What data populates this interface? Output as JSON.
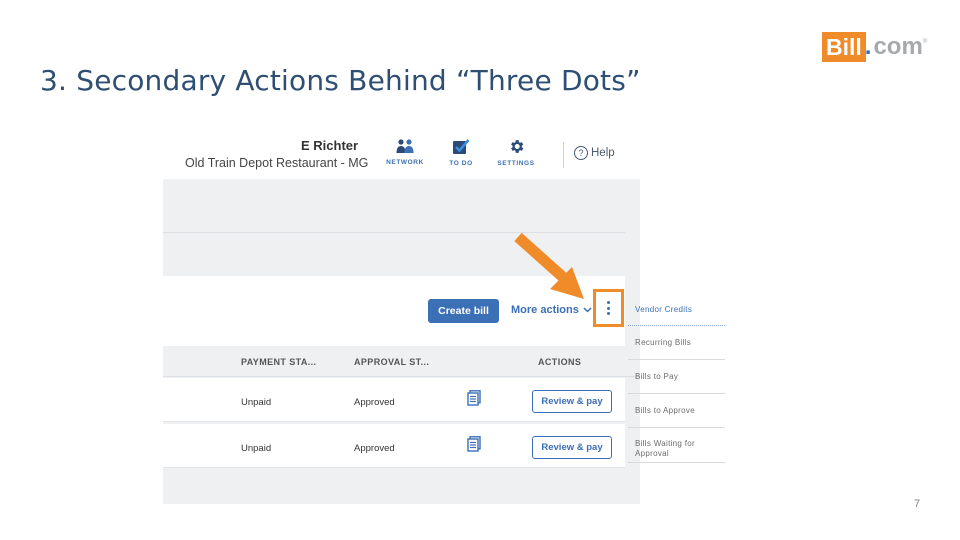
{
  "slide": {
    "title": "3. Secondary Actions Behind “Three Dots”",
    "page_number": "7",
    "logo": {
      "box_text": "Bill",
      "rest_text": "com",
      "dot_text": ".",
      "tm": "®"
    }
  },
  "app": {
    "user_name": "E Richter",
    "company": "Old Train Depot Restaurant - MG",
    "nav": [
      {
        "label": "NETWORK",
        "icon": "people-icon"
      },
      {
        "label": "TO DO",
        "icon": "checkbox-icon"
      },
      {
        "label": "SETTINGS",
        "icon": "gear-icon"
      }
    ],
    "help_label": "Help",
    "help_glyph": "?",
    "create_bill_label": "Create bill",
    "more_actions_label": "More actions",
    "columns": [
      "PAYMENT STA...",
      "APPROVAL ST...",
      "ACTIONS"
    ],
    "rows": [
      {
        "payment_status": "Unpaid",
        "approval_status": "Approved",
        "action": "Review & pay"
      },
      {
        "payment_status": "Unpaid",
        "approval_status": "Approved",
        "action": "Review & pay"
      }
    ],
    "dropdown": [
      "Vendor Credits",
      "Recurring Bills",
      "Bills to Pay",
      "Bills to Approve",
      "Bills Waiting for Approval"
    ]
  },
  "colors": {
    "accent": "#3b6fb6",
    "highlight": "#f08b2a",
    "title": "#2e4f73"
  }
}
